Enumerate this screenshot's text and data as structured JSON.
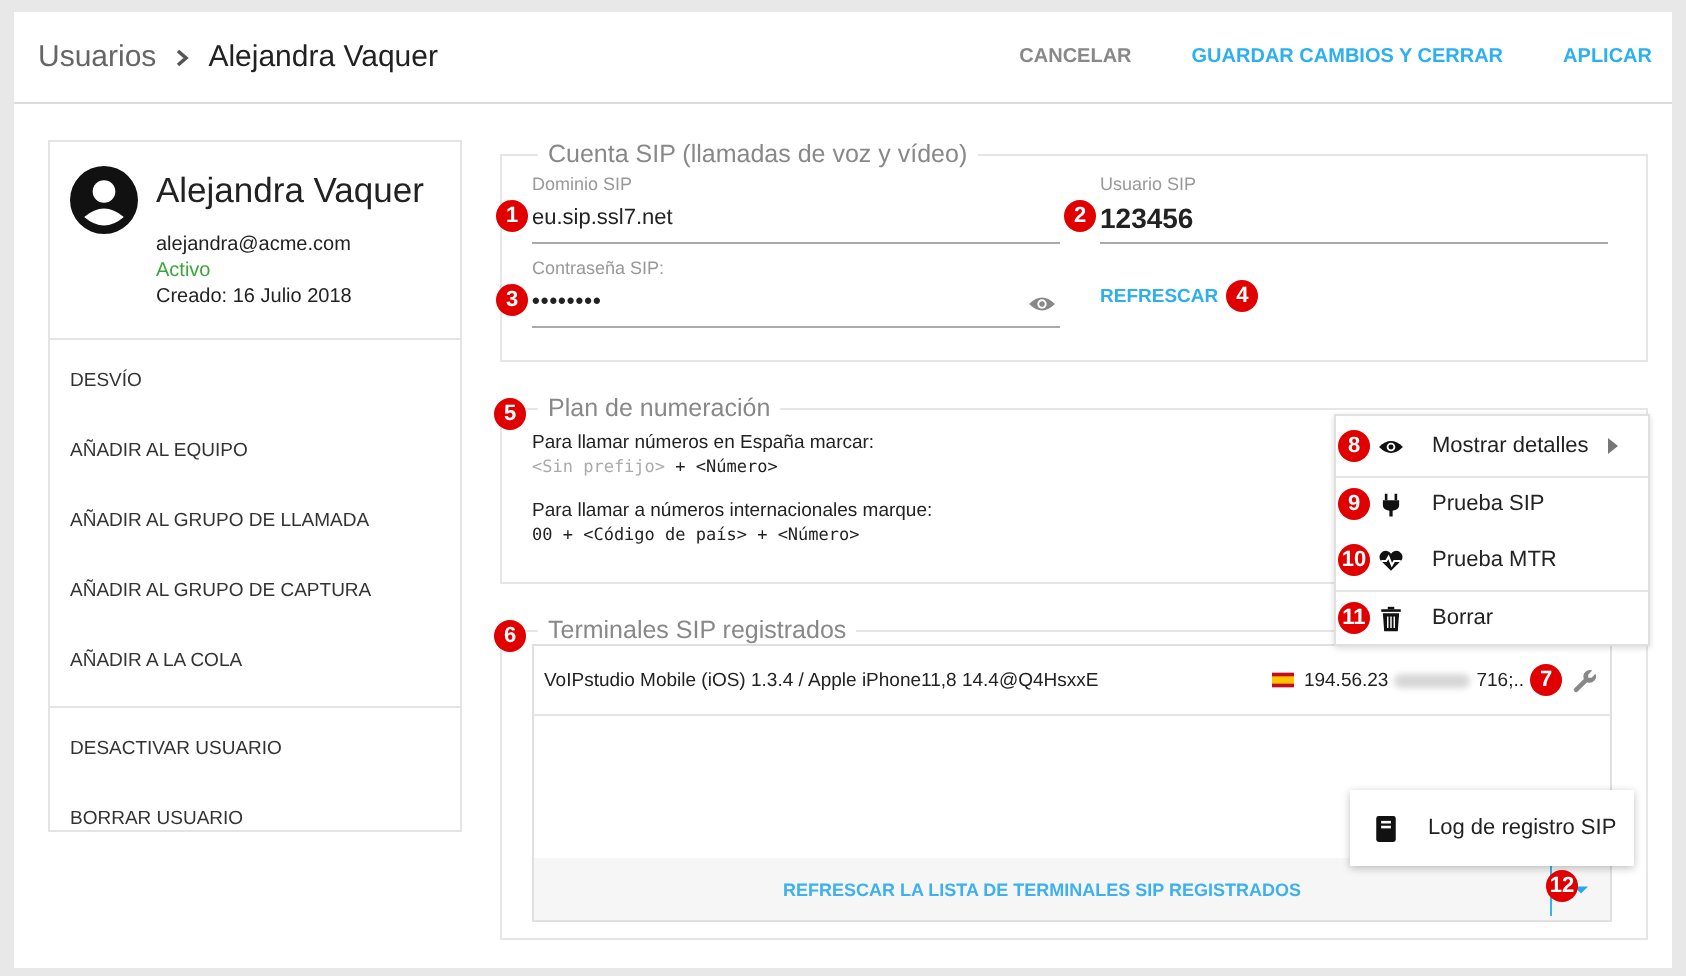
{
  "header": {
    "breadcrumb": [
      {
        "label": "Usuarios"
      },
      {
        "label": "Alejandra Vaquer"
      }
    ],
    "actions": [
      {
        "label": "CANCELAR",
        "primary": false
      },
      {
        "label": "GUARDAR CAMBIOS Y CERRAR",
        "primary": true
      },
      {
        "label": "APLICAR",
        "primary": true
      }
    ]
  },
  "profile": {
    "name": "Alejandra Vaquer",
    "email": "alejandra@acme.com",
    "status": "Activo",
    "created": "Creado: 16 Julio 2018"
  },
  "sidebar": {
    "groups": [
      {
        "items": [
          {
            "label": "DESVÍO"
          },
          {
            "label": "AÑADIR AL EQUIPO"
          },
          {
            "label": "AÑADIR AL GRUPO DE LLAMADA"
          },
          {
            "label": "AÑADIR AL GRUPO DE CAPTURA"
          },
          {
            "label": "AÑADIR A LA COLA"
          }
        ]
      },
      {
        "items": [
          {
            "label": "DESACTIVAR USUARIO"
          },
          {
            "label": "BORRAR USUARIO"
          }
        ]
      }
    ]
  },
  "sip_account": {
    "title": "Cuenta SIP (llamadas de voz y vídeo)",
    "domain": {
      "label": "Dominio SIP",
      "value": "eu.sip.ssl7.net",
      "badge": "1"
    },
    "user": {
      "label": "Usuario SIP",
      "value": "123456",
      "badge": "2"
    },
    "password": {
      "label": "Contraseña SIP:",
      "value": "••••••••",
      "badge": "3"
    },
    "refresh": {
      "label": "REFRESCAR",
      "badge": "4"
    }
  },
  "numbering": {
    "title": "Plan de numeración",
    "badge": "5",
    "lines": [
      {
        "text": "Para llamar números en España marcar:",
        "hint": "<Sin prefijo>",
        "code": " + <Número>"
      },
      {
        "text": "Para llamar a números internacionales marque:",
        "code": "00 + <Código de país> + <Número>"
      }
    ]
  },
  "terminals": {
    "title": "Terminales SIP registrados",
    "badge": "6",
    "rows": [
      {
        "device": "VoIPstudio Mobile (iOS) 1.3.4 / Apple iPhone11,8 14.4@Q4HsxxE",
        "ip_start": "194.56.23",
        "ip_end": "716;..",
        "badge": "7"
      }
    ],
    "refresh_button": "REFRESCAR LA LISTA DE TERMINALES SIP REGISTRADOS",
    "dropdown_badge": "12"
  },
  "context_menu": [
    {
      "kind": "eye",
      "label": "Mostrar detalles",
      "badge": "8",
      "submenu": true,
      "divider": true
    },
    {
      "kind": "plug",
      "label": "Prueba SIP",
      "badge": "9",
      "submenu": false,
      "divider": false
    },
    {
      "kind": "heart",
      "label": "Prueba MTR",
      "badge": "10",
      "submenu": false,
      "divider": true
    },
    {
      "kind": "trash",
      "label": "Borrar",
      "badge": "11",
      "submenu": false,
      "divider": false
    }
  ],
  "dropdown_menu": [
    {
      "kind": "book",
      "label": "Log de registro SIP"
    }
  ]
}
